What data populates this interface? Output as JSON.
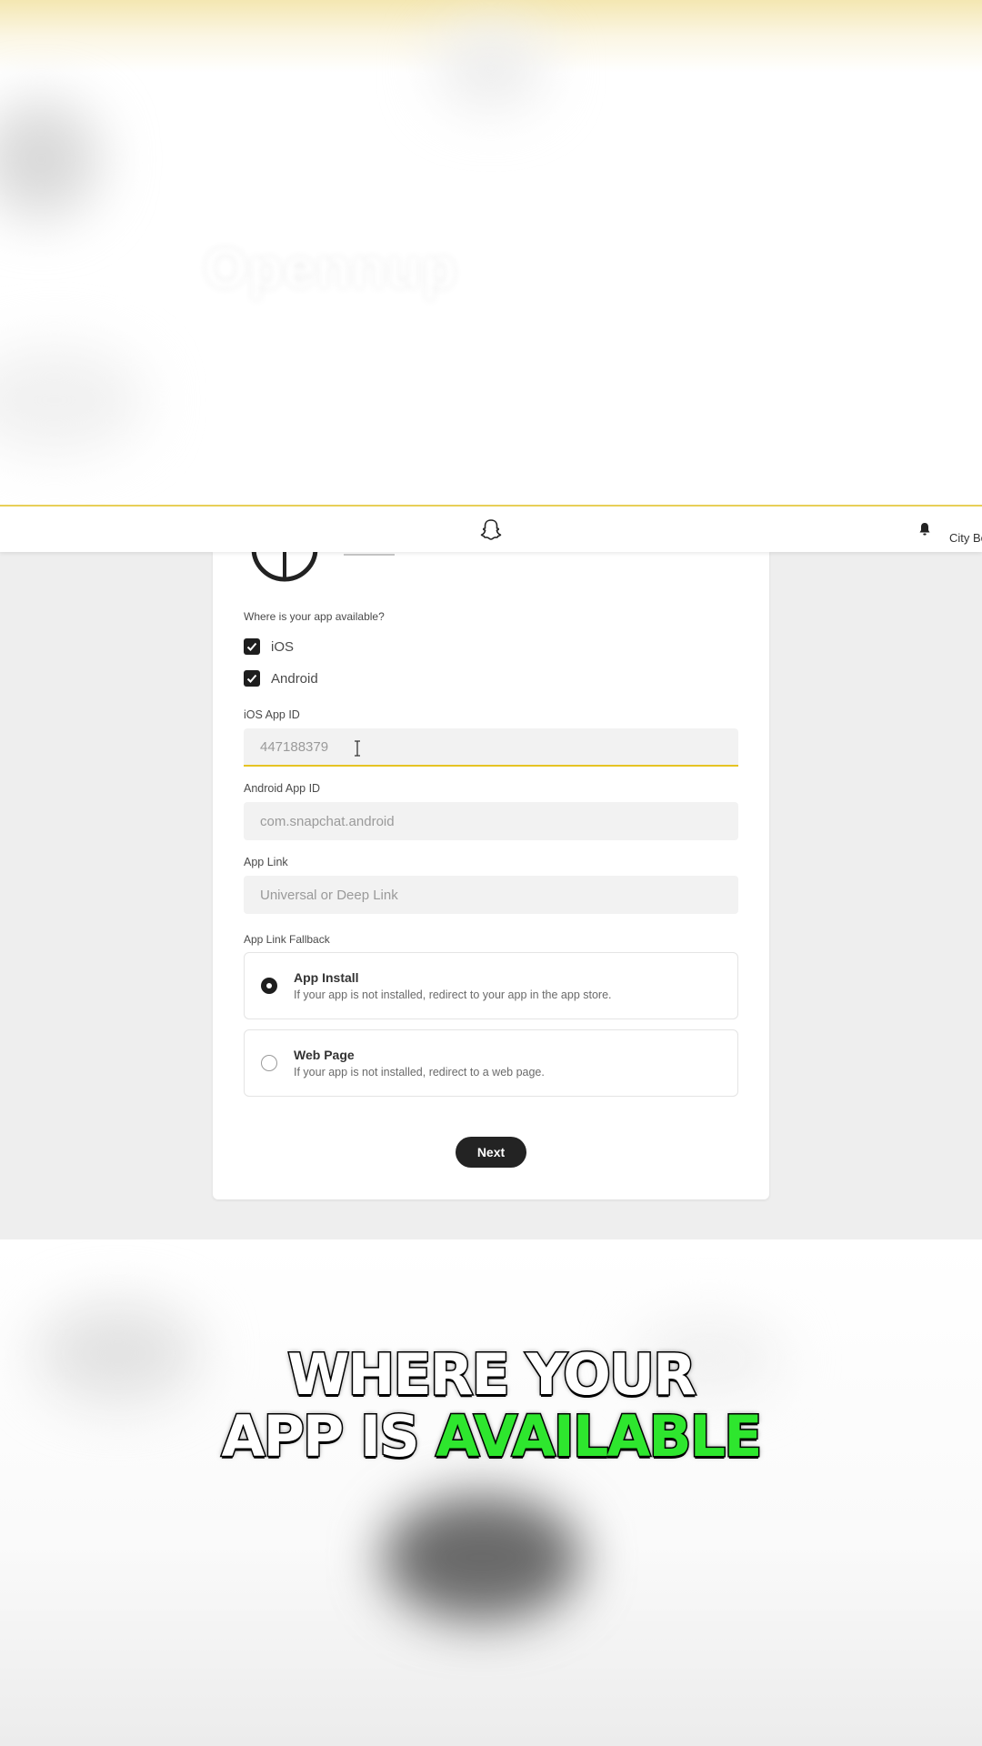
{
  "watermark": {
    "brand_text": "Opennup"
  },
  "header": {
    "org_name": "City Bo"
  },
  "form": {
    "availability_question": "Where is your app available?",
    "platforms": [
      {
        "label": "iOS",
        "checked": true
      },
      {
        "label": "Android",
        "checked": true
      }
    ],
    "ios_app_id": {
      "label": "iOS App ID",
      "value": "447188379"
    },
    "android_app_id": {
      "label": "Android App ID",
      "placeholder": "com.snapchat.android"
    },
    "app_link": {
      "label": "App Link",
      "placeholder": "Universal or Deep Link"
    },
    "fallback": {
      "label": "App Link Fallback",
      "options": [
        {
          "title": "App Install",
          "description": "If your app is not installed, redirect to your app in the app store.",
          "selected": true
        },
        {
          "title": "Web Page",
          "description": "If your app is not installed, redirect to a web page.",
          "selected": false
        }
      ]
    },
    "next_label": "Next"
  },
  "caption": {
    "line1": "WHERE YOUR",
    "line2_white": "APP IS",
    "line2_green": "AVAILABLE"
  },
  "colors": {
    "accent_yellow": "#e6c323",
    "caption_green": "#2ee62e",
    "button_dark": "#232323"
  }
}
